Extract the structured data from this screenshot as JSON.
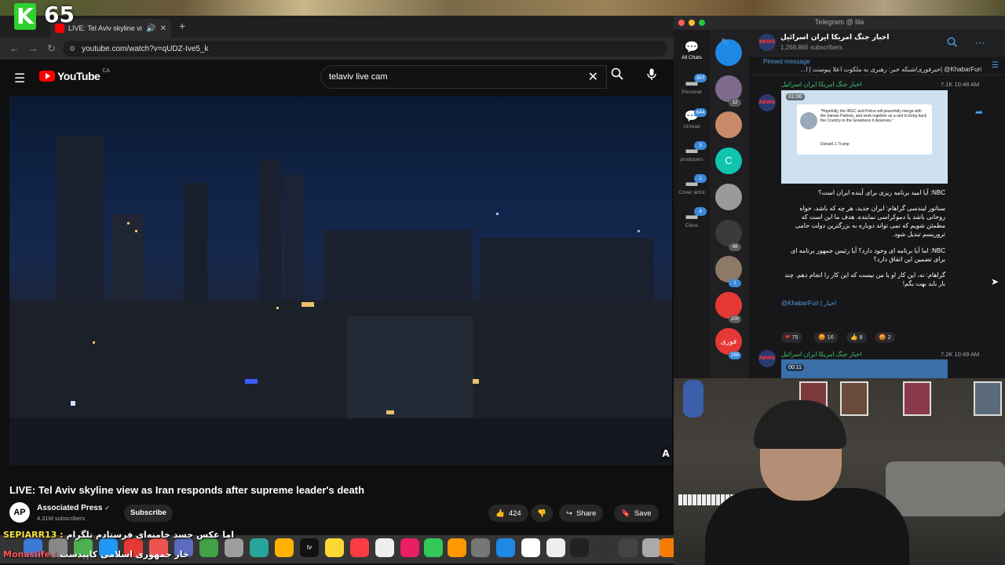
{
  "overlay": {
    "stream_letter": "K",
    "stream_count": "65"
  },
  "browser": {
    "tab_title": "LIVE: Tel Aviv skyline view",
    "url": "youtube.com/watch?v=qUDZ-Ive5_k"
  },
  "youtube": {
    "logo_text": "YouTube",
    "country": "CA",
    "search_value": "telaviv live cam",
    "video_title": "LIVE: Tel Aviv skyline view as Iran responds after supreme leader's death",
    "channel_initials": "AP",
    "channel_name": "Associated Press",
    "channel_subs": "4.31M subscribers",
    "subscribe_label": "Subscribe",
    "likes": "424",
    "share_label": "Share",
    "save_label": "Save",
    "overlay_letter": "A"
  },
  "stream_chat": [
    {
      "user": "SEPIARR13 :",
      "text": "اما عکس جسد خامنه‌ای فرستادم تلگرام"
    },
    {
      "user": "Monasiife :",
      "text": "خار جمهوری اسلامی کاپیدست"
    }
  ],
  "telegram": {
    "window_title": "Telegram @ lila",
    "folders": [
      {
        "label": "All Chats",
        "badge": ""
      },
      {
        "label": "Personal",
        "badge": "397"
      },
      {
        "label": "Unread",
        "badge": "644"
      },
      {
        "label": "producers",
        "badge": "3"
      },
      {
        "label": "Cover artist",
        "badge": "1"
      },
      {
        "label": "Class",
        "badge": "4"
      }
    ],
    "chat_badges": [
      "12",
      "48",
      "1",
      "200",
      "288"
    ],
    "chat_c_letter": "C",
    "chat_foori_text": "فوری",
    "channel_name": "اخبار جنگ امریکا ایران اسرائیل",
    "subscribers": "1,268,865 subscribers",
    "pinned_label": "Pinned message",
    "pinned_text": "KhabarFuri@ |خبرفوری/شبکه خبر: رهبری به ملکوت اعلا پیوست | ا...",
    "messages": [
      {
        "sender": "اخبار جنگ امریکا ایران اسرائیل",
        "views": "7.1K 10:48 AM",
        "duration": "01:06",
        "image_text": "\"Hopefully, the IRGC and Police will peacefully merge with the Iranian Patriots, and work together as a unit to bring back the Country to the Greatness it deserves.\"",
        "image_sign": "Donald J. Trump",
        "lines": [
          "NBC: آیا امید برنامه ریزی برای آینده ایران است؟",
          "سناتور لیندسی گراهام: ایران جدید، هر چه که باشد، خواه روحانی باشد یا دموکراسی نماینده. هدف ما این است که مطمئن شویم که نمی تواند دوباره به بزرگترین دولت حامی تروریسم تبدیل شود.",
          "NBC: اما آیا برنامه ای وجود دارد؟ آیا رئیس جمهور برنامه ای برای تضمین این اتفاق دارد؟",
          "گراهام: نه، این کار او یا من نیست که این کار را انجام دهم. چند بار باید بهت بگم!"
        ],
        "signature": "@KhabarFuri | اخبار",
        "reactions": [
          {
            "emoji": "❤",
            "count": "75"
          },
          {
            "emoji": "😡",
            "count": "16"
          },
          {
            "emoji": "👍",
            "count": "8"
          },
          {
            "emoji": "😡",
            "count": "2"
          }
        ]
      },
      {
        "sender": "اخبار جنگ امریکا ایران اسرائیل",
        "views": "7.2K 10:49 AM",
        "duration": "00:11"
      }
    ]
  }
}
